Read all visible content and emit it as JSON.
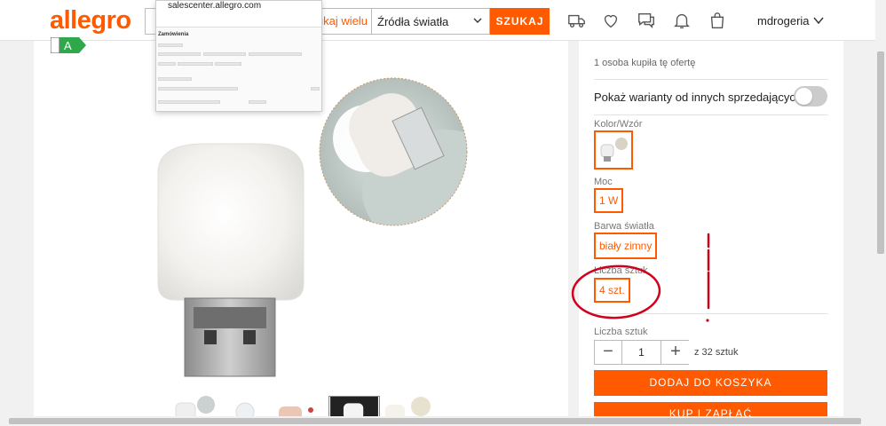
{
  "header": {
    "logo": "allegro",
    "search_multi": "szukaj wielu",
    "category": "Źródła światła",
    "search_button": "SZUKAJ",
    "username": "mdrogeria"
  },
  "popup": {
    "url": "salescenter.allegro.com",
    "title": "Zamówienia"
  },
  "energy": {
    "class": "A"
  },
  "buy_box": {
    "buyers": "1 osoba kupiła tę ofertę",
    "variants_toggle_label": "Pokaż warianty od innych sprzedających",
    "color_label": "Kolor/Wzór",
    "power_label": "Moc",
    "power_value": "1 W",
    "light_label": "Barwa światła",
    "light_value": "biały zimny",
    "qty_pack_label": "Liczba sztuk",
    "qty_pack_value": "4 szt.",
    "qty_label": "Liczba sztuk",
    "qty_value": "1",
    "stock": "z 32 sztuk",
    "add_to_cart": "DODAJ DO KOSZYKA",
    "buy_now": "KUP I ZAPŁAĆ"
  },
  "colors": {
    "brand": "#ff5a00",
    "annotation": "#d0021b",
    "energy_green": "#2ea84a"
  }
}
